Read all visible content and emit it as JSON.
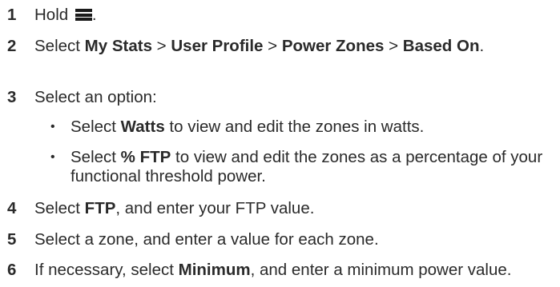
{
  "steps": [
    {
      "num": "1",
      "pre": "Hold",
      "post": "."
    },
    {
      "num": "2",
      "s": "Select ",
      "a": "My Stats",
      "g1": " > ",
      "b": "User Profile",
      "g2": " > ",
      "c": "Power Zones",
      "g3": " > ",
      "d": "Based On",
      "e": "."
    },
    {
      "num": "3",
      "text": "Select an option:"
    },
    {
      "num": "4",
      "s": "Select ",
      "a": "FTP",
      "e": ", and enter your FTP value."
    },
    {
      "num": "5",
      "text": "Select a zone, and enter a value for each zone."
    },
    {
      "num": "6",
      "s": "If necessary, select ",
      "a": "Minimum",
      "e": ", and enter a minimum power value."
    }
  ],
  "bullets": [
    {
      "dot": "•",
      "s": "Select ",
      "a": "Watts",
      "e": " to view and edit the zones in watts."
    },
    {
      "dot": "•",
      "s": "Select ",
      "a": "% FTP",
      "e": " to view and edit the zones as a percentage of your functional threshold power."
    }
  ],
  "icons": {
    "menu": "menu-icon"
  }
}
